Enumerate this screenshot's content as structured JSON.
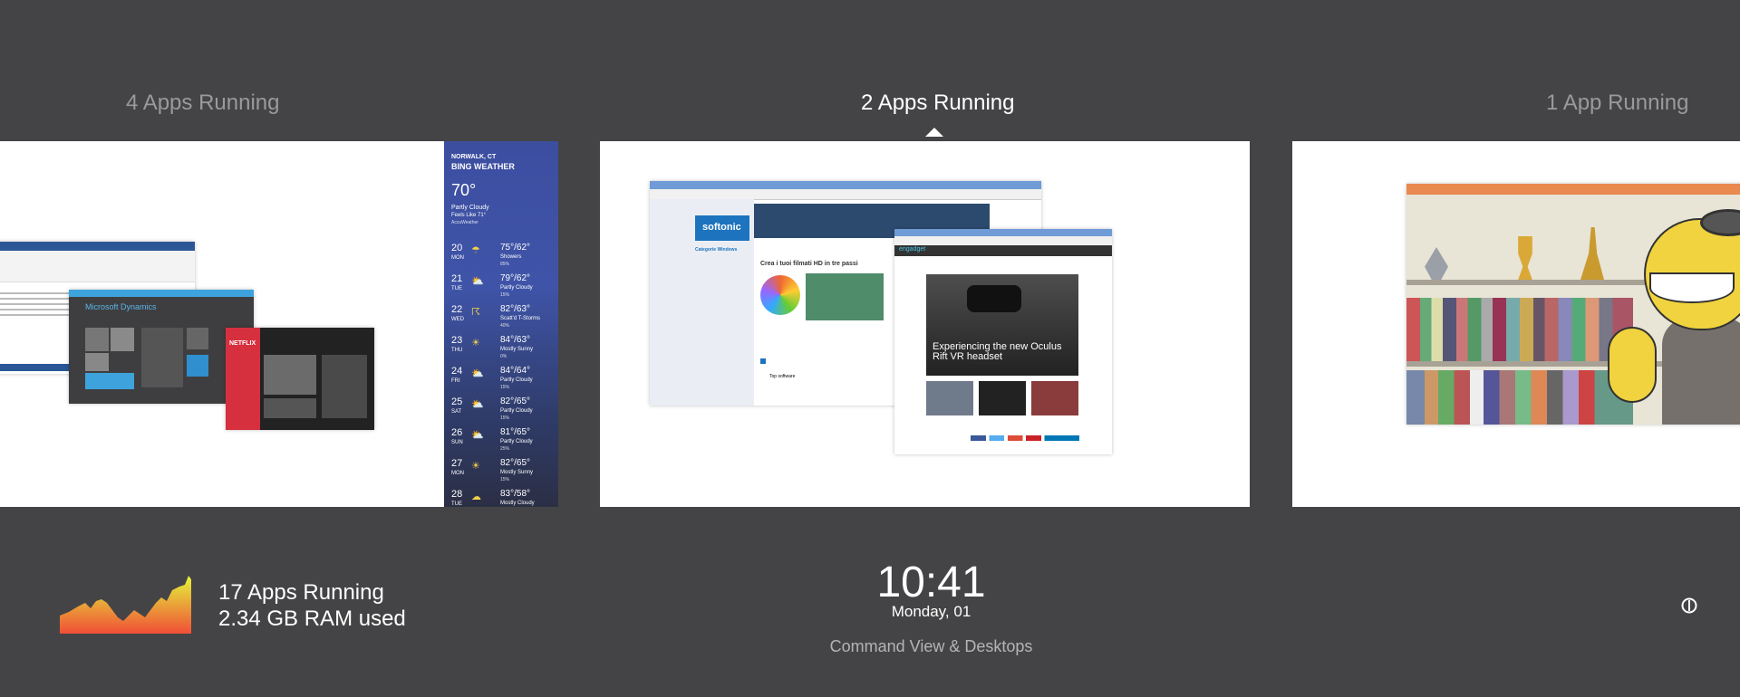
{
  "groups": [
    {
      "title": "4 Apps Running"
    },
    {
      "title": "2 Apps Running"
    },
    {
      "title": "1 App Running"
    }
  ],
  "weather": {
    "location": "NORWALK, CT",
    "brand": "BING WEATHER",
    "temperature": "70°",
    "condition": "Partly Cloudy",
    "feels_like": "Feels Like 71°",
    "provider": "AccuWeather",
    "forecast": [
      {
        "day": "20",
        "weekday": "MON",
        "temps": "75°/62°",
        "cond": "Showers",
        "precip": "85%"
      },
      {
        "day": "21",
        "weekday": "TUE",
        "temps": "79°/62°",
        "cond": "Partly Cloudy",
        "precip": "15%"
      },
      {
        "day": "22",
        "weekday": "WED",
        "temps": "82°/63°",
        "cond": "Scatt'd T-Storms",
        "precip": "40%"
      },
      {
        "day": "23",
        "weekday": "THU",
        "temps": "84°/63°",
        "cond": "Mostly Sunny",
        "precip": "0%"
      },
      {
        "day": "24",
        "weekday": "FRI",
        "temps": "84°/64°",
        "cond": "Partly Cloudy",
        "precip": "15%"
      },
      {
        "day": "25",
        "weekday": "SAT",
        "temps": "82°/65°",
        "cond": "Partly Cloudy",
        "precip": "15%"
      },
      {
        "day": "26",
        "weekday": "SUN",
        "temps": "81°/65°",
        "cond": "Partly Cloudy",
        "precip": "25%"
      },
      {
        "day": "27",
        "weekday": "MON",
        "temps": "82°/65°",
        "cond": "Mostly Sunny",
        "precip": "15%"
      },
      {
        "day": "28",
        "weekday": "TUE",
        "temps": "83°/58°",
        "cond": "Mostly Cloudy",
        "precip": ""
      }
    ]
  },
  "windows": {
    "dynamics_title": "Microsoft Dynamics",
    "netflix_logo": "NETFLIX",
    "softonic_logo": "softonic",
    "softonic_headline": "Crea i tuoi filmati HD in tre passi",
    "softonic_category": "Categorie Windows",
    "softonic_tab1": "Top software",
    "engadget_logo": "engadget",
    "engadget_headline": "Experiencing the new Oculus Rift VR headset"
  },
  "stats": {
    "apps_running": "17 Apps Running",
    "ram_used": "2.34 GB RAM used"
  },
  "clock": {
    "time": "10:41",
    "date": "Monday, 01"
  },
  "footer": {
    "command_view": "Command View & Desktops"
  },
  "colors": {
    "background": "#444446",
    "inactive_title": "#9a9a9c",
    "graph_top": "#e4f53b",
    "graph_bottom": "#f04f36"
  },
  "icons": {
    "power": "power-icon"
  }
}
